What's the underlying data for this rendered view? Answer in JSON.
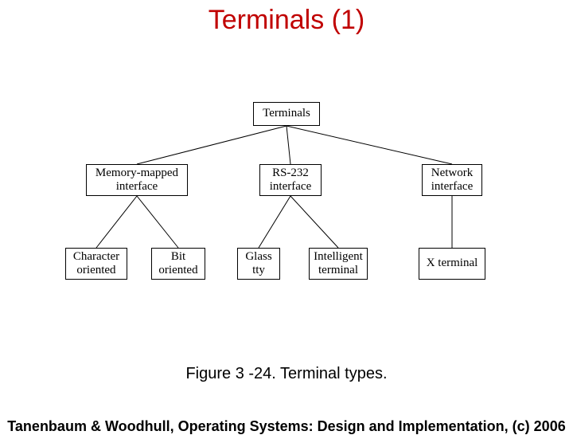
{
  "title": "Terminals (1)",
  "caption": "Figure 3 -24. Terminal types.",
  "footer": "Tanenbaum & Woodhull, Operating Systems: Design and Implementation, (c) 2006",
  "nodes": {
    "root": "Terminals",
    "mem": "Memory-mapped\ninterface",
    "rs232": "RS-232\ninterface",
    "net": "Network\ninterface",
    "char": "Character\noriented",
    "bit": "Bit\noriented",
    "glass": "Glass\ntty",
    "intel": "Intelligent\nterminal",
    "xterm": "X terminal"
  },
  "chart_data": {
    "type": "tree",
    "title": "Terminal types",
    "root": {
      "label": "Terminals",
      "children": [
        {
          "label": "Memory-mapped interface",
          "children": [
            {
              "label": "Character oriented"
            },
            {
              "label": "Bit oriented"
            }
          ]
        },
        {
          "label": "RS-232 interface",
          "children": [
            {
              "label": "Glass tty"
            },
            {
              "label": "Intelligent terminal"
            }
          ]
        },
        {
          "label": "Network interface",
          "children": [
            {
              "label": "X terminal"
            }
          ]
        }
      ]
    }
  }
}
